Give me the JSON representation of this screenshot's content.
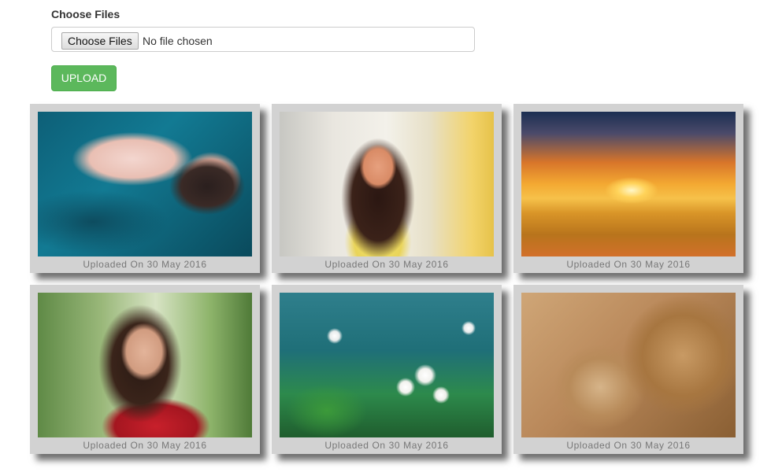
{
  "form": {
    "label": "Choose Files",
    "file_button_label": "Choose Files",
    "file_status": "No file chosen",
    "upload_label": "UPLOAD",
    "upload_color": "#5cb85c"
  },
  "gallery": {
    "items": [
      {
        "caption": "Uploaded On 30 May 2016"
      },
      {
        "caption": "Uploaded On 30 May 2016"
      },
      {
        "caption": "Uploaded On 30 May 2016"
      },
      {
        "caption": "Uploaded On 30 May 2016"
      },
      {
        "caption": "Uploaded On 30 May 2016"
      },
      {
        "caption": "Uploaded On 30 May 2016"
      }
    ]
  }
}
